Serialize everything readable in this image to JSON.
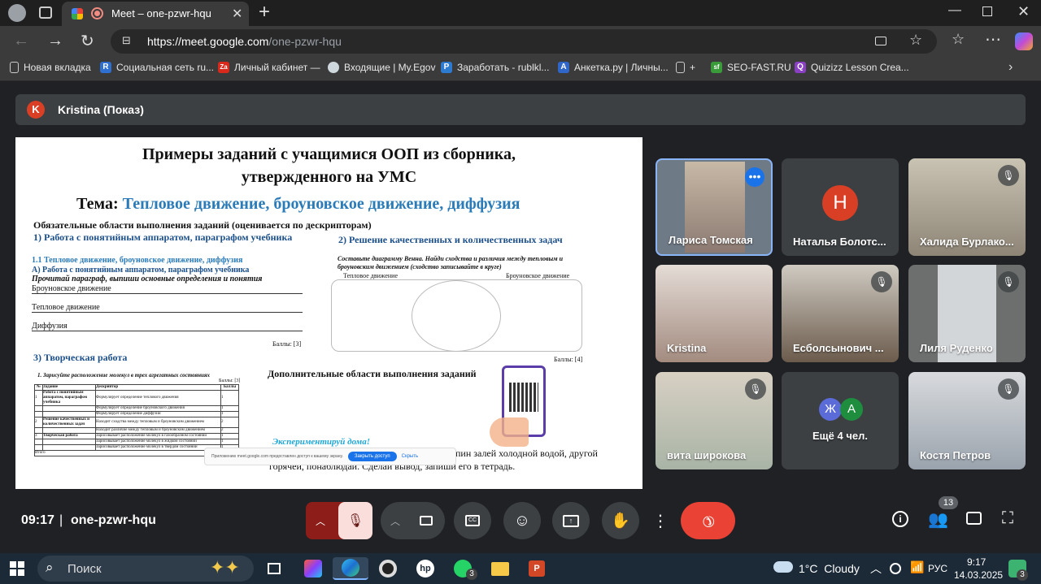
{
  "browser": {
    "tab_title": "Meet – one-pzwr-hqu",
    "new_tab_symbol": "+",
    "url_host": "https://meet.google.com",
    "url_path": "/one-pzwr-hqu"
  },
  "bookmarks": [
    {
      "label": "Новая вкладка",
      "icon": "page-icon"
    },
    {
      "label": "Социальная сеть ru...",
      "icon": "R",
      "color": "#2e6fd0"
    },
    {
      "label": "Личный кабинет —",
      "icon": "Za",
      "color": "#d9291c"
    },
    {
      "label": "Входящие | My.Egov",
      "icon": "globe-icon"
    },
    {
      "label": "Заработать - rublkl...",
      "icon": "P",
      "color": "#2d7bd1"
    },
    {
      "label": "Анкетка.ру | Личны...",
      "icon": "A",
      "color": "#2f66c7"
    },
    {
      "label": "+",
      "icon": "page-icon"
    },
    {
      "label": "SEO-FAST.RU",
      "icon": "sf",
      "color": "#3a9b3a"
    },
    {
      "label": "Quizizz Lesson Crea...",
      "icon": "Q",
      "color": "#8b3fc4"
    }
  ],
  "meet": {
    "presenter_initial": "K",
    "presenter_label": "Kristina (Показ)",
    "time": "09:17",
    "meeting_code": "one-pzwr-hqu",
    "participants_count": "13"
  },
  "participants": [
    {
      "name": "Лариса Томская",
      "muted": false
    },
    {
      "name": "Наталья Болотс...",
      "initial": "Н",
      "muted": false
    },
    {
      "name": "Халида Бурлако...",
      "muted": true
    },
    {
      "name": "Kristina",
      "muted": false
    },
    {
      "name": "Есболсынович ...",
      "muted": true
    },
    {
      "name": "Лиля Руденко",
      "muted": true
    },
    {
      "name": "вита широкова",
      "muted": true
    },
    {
      "name": "Ещё 4 чел.",
      "initials": [
        "Ж",
        "А"
      ]
    },
    {
      "name": "Костя Петров",
      "muted": true
    }
  ],
  "slide": {
    "title_line1": "Примеры  заданий с учащимися ООП из сборника,",
    "title_line2": "утвержденного на УМС",
    "theme_prefix": "Тема: ",
    "theme": "Тепловое движение, броуновское движение, диффузия",
    "required_areas": "Обязательные области выполнения заданий (оценивается по дескрипторам)",
    "section1": "1) Работа с понятийным аппаратом,  параграфом учебника",
    "section2": "2) Решение качественных  и количественных задач",
    "sub11": "1.1  Тепловое движение, броуновское движение, диффузия",
    "subA": "А) Работа с понятийным аппаратом, параграфом учебника",
    "read_task": "Прочитай параграф, выпиши основные определения и понятия",
    "line_brown": "Броуновское движение",
    "line_thermal": "Тепловое движение",
    "line_diffusion": "Диффузия",
    "score3": "Баллы: [3]",
    "venn_task": "Составьте  диаграмму  Венна.  Найди  сходства  и  различия  между тепловым и броуновским движением (сходство записывайте в круге)",
    "venn_left": "Тепловое движение",
    "venn_right": "Броуновское движение",
    "score4": "Баллы: [4]",
    "section3": "3) Творческая работа",
    "table_task": "1. Зарисуйте расположение молекул в трех агрегатных состояниях",
    "table_score": "Баллы: [3]",
    "table_headers": [
      "№",
      "Задание",
      "Дескриптор",
      "Баллы"
    ],
    "table_rows": [
      [
        "1",
        "Работа с понятийным аппаратом, параграфом учебника",
        "Формулирует определение теплового движения",
        "1"
      ],
      [
        "",
        "",
        "Формулирует определение броуновского движения",
        "1"
      ],
      [
        "",
        "",
        "Формулирует определение диффузии",
        "1"
      ],
      [
        "2",
        "Решение качественных и количественных задач",
        "Находит сходства между тепловым и броуновским движением",
        "2"
      ],
      [
        "",
        "",
        "Находит различие между тепловым и броуновским движением",
        "2"
      ],
      [
        "3",
        "Творческая работа",
        "Зарисовывает расположение молекул в газообразном состоянии",
        "1"
      ],
      [
        "",
        "",
        "Зарисовывает расположение молекул в жидком состоянии",
        "1"
      ],
      [
        "",
        "",
        "Зарисовывает расположение молекул в твердом состоянии",
        "1"
      ]
    ],
    "table_total": "Итого",
    "extra_areas": "Дополнительные области выполнения заданий",
    "experiment": "Экспериментируй дома!",
    "experiment_text1": "пин залей холодной водой, другой",
    "experiment_text2": "горячей, понаблюдай. Сделай вывод, запиши его  в тетрадь.",
    "share_notice": "Приложению meet.google.com предоставлен доступ к вашему экрану.",
    "stop_sharing": "Закрыть доступ",
    "hide": "Скрыть"
  },
  "taskbar": {
    "search": "Поиск",
    "weather": "1°C  Cloudy",
    "lang": "РУС",
    "time": "9:17",
    "date": "14.03.2025",
    "whatsapp_badge": "3",
    "notif_badge": "3"
  }
}
